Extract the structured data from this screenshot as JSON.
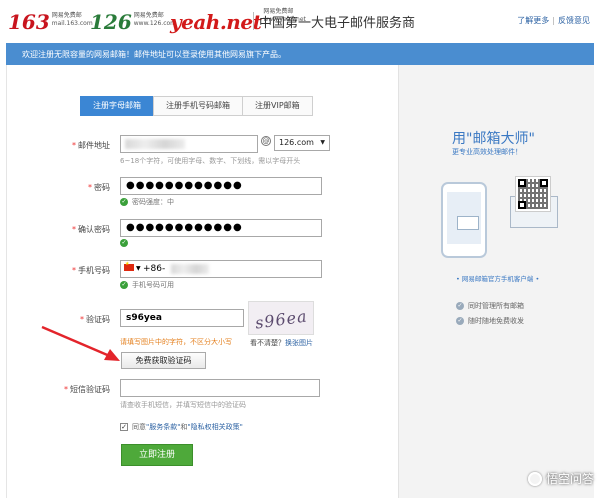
{
  "header": {
    "logo_163": "163",
    "logo_163_sub": "网易免费邮\nmail.163.com",
    "logo_126": "126",
    "logo_126_sub": "网易免费邮\nwww.126.com",
    "logo_yeah": "yeah.net",
    "logo_yeah_sub": "网易免费邮\nwww.yeah.net",
    "title": "中国第一大电子邮件服务商",
    "link_more": "了解更多",
    "link_feedback": "反馈意见"
  },
  "banner": {
    "text": "欢迎注册无限容量的网易邮箱！邮件地址可以登录使用其他网易旗下产品。"
  },
  "tabs": [
    {
      "label": "注册字母邮箱",
      "active": true
    },
    {
      "label": "注册手机号码邮箱",
      "active": false
    },
    {
      "label": "注册VIP邮箱",
      "active": false
    }
  ],
  "form": {
    "email": {
      "label": "邮件地址",
      "value": "",
      "domain": "126.com",
      "hint": "6~18个字符，可使用字母、数字、下划线，需以字母开头"
    },
    "password": {
      "label": "密码",
      "value": "●●●●●●●●●●●●",
      "strength": "密码强度：中"
    },
    "confirm": {
      "label": "确认密码",
      "value": "●●●●●●●●●●●●"
    },
    "phone": {
      "label": "手机号码",
      "prefix": "+86-",
      "status": "手机号码可用"
    },
    "captcha": {
      "label": "验证码",
      "value": "s96yea",
      "image_text": "s96ea",
      "warn": "请填写图片中的字符，不区分大小写",
      "change_prefix": "看不清楚？",
      "change_link": "换张图片",
      "get_code_label": "免费获取验证码"
    },
    "sms": {
      "label": "短信验证码",
      "hint": "请查收手机短信，并填写短信中的验证码"
    },
    "agree": {
      "prefix": "同意",
      "terms": "\"服务条款\"",
      "and": "和",
      "privacy": "\"隐私权相关政策\""
    },
    "submit_label": "立即注册"
  },
  "side": {
    "title": "用\"邮箱大师\"",
    "subtitle": "更专业高效处理邮件！",
    "caption": "• 网易邮箱官方手机客户端 •",
    "features": [
      "同时管理所有邮箱",
      "随时随地免费收发"
    ]
  },
  "watermark": "悟空问答",
  "colors": {
    "banner": "#4a8dd0",
    "tab_active": "#3b86d4",
    "submit": "#4ea93a",
    "ok": "#3aa03a",
    "warn": "#e4801f",
    "side_text": "#3a78c3"
  }
}
